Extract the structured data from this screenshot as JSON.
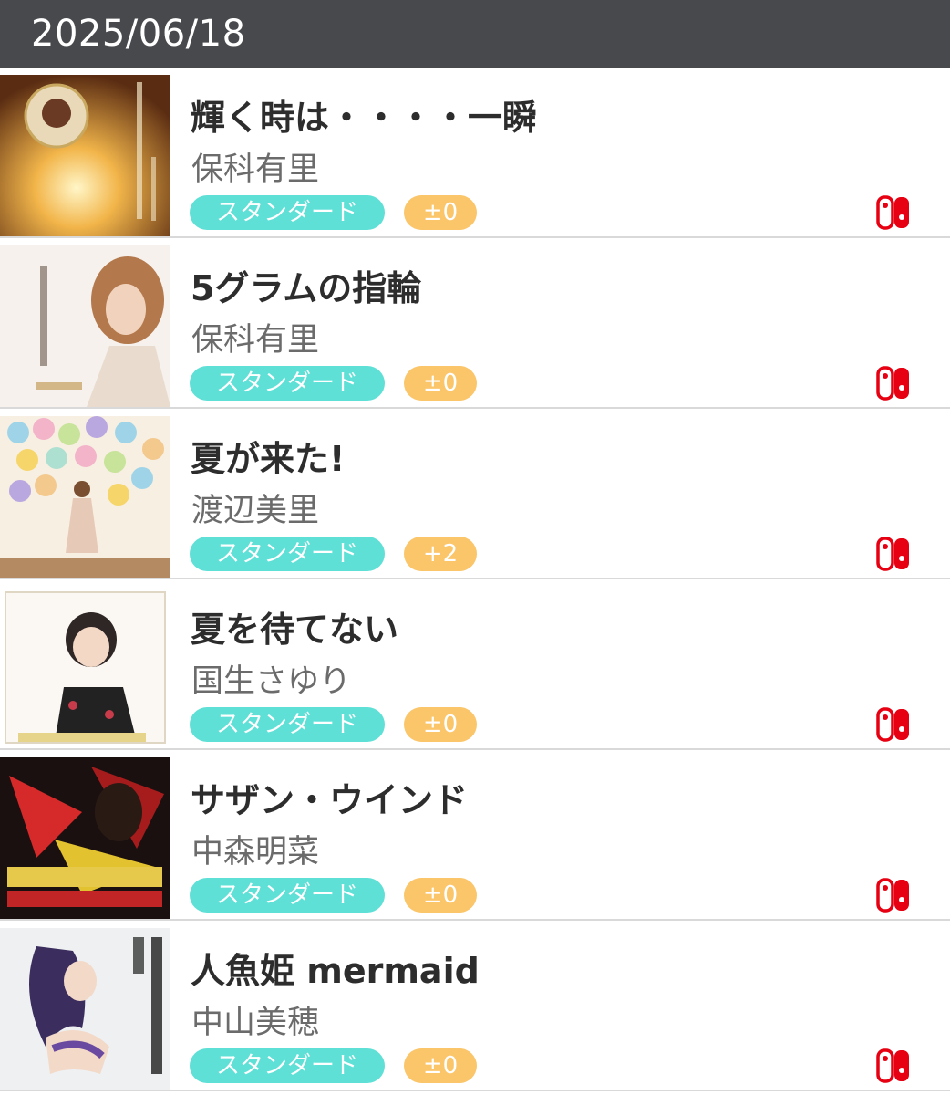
{
  "header": {
    "date": "2025/06/18"
  },
  "accent": {
    "difficulty_color": "#5fe0d6",
    "key_color": "#fbc56a",
    "switch_color": "#e60012",
    "header_bg": "#47494d"
  },
  "songs": [
    {
      "title": "輝く時は・・・・一瞬",
      "artist": "保科有里",
      "difficulty": "スタンダード",
      "key": "±0",
      "platform_icon": "nintendo-switch-icon"
    },
    {
      "title": "5グラムの指輪",
      "artist": "保科有里",
      "difficulty": "スタンダード",
      "key": "±0",
      "platform_icon": "nintendo-switch-icon"
    },
    {
      "title": "夏が来た!",
      "artist": "渡辺美里",
      "difficulty": "スタンダード",
      "key": "+2",
      "platform_icon": "nintendo-switch-icon"
    },
    {
      "title": "夏を待てない",
      "artist": "国生さゆり",
      "difficulty": "スタンダード",
      "key": "±0",
      "platform_icon": "nintendo-switch-icon"
    },
    {
      "title": "サザン・ウインド",
      "artist": "中森明菜",
      "difficulty": "スタンダード",
      "key": "±0",
      "platform_icon": "nintendo-switch-icon"
    },
    {
      "title": "人魚姫 mermaid",
      "artist": "中山美穂",
      "difficulty": "スタンダード",
      "key": "±0",
      "platform_icon": "nintendo-switch-icon"
    }
  ]
}
